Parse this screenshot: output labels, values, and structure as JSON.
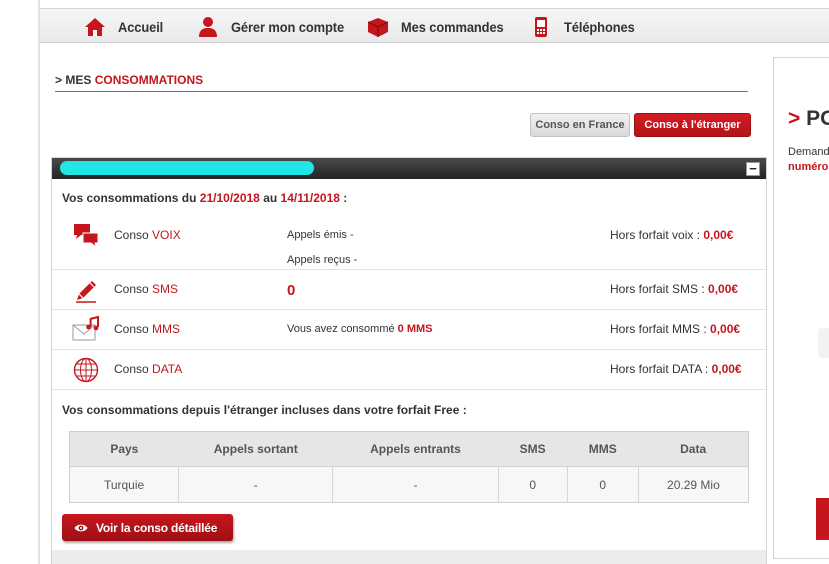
{
  "nav": {
    "items": [
      {
        "label": "Accueil",
        "icon": "home-icon"
      },
      {
        "label": "Gérer mon compte",
        "icon": "user-icon"
      },
      {
        "label": "Mes commandes",
        "icon": "box-icon"
      },
      {
        "label": "Téléphones",
        "icon": "phone-icon"
      }
    ]
  },
  "section": {
    "prefix": "> MES ",
    "highlight": "CONSOMMATIONS"
  },
  "buttons": {
    "france": "Conso en France",
    "abroad": "Conso à l'étranger",
    "detail": "Voir la conso détaillée"
  },
  "box": {
    "collapse": "−"
  },
  "period": {
    "prefix": "Vos consommations du ",
    "start": "21/10/2018",
    "middle": " au ",
    "end": "14/11/2018",
    "suffix": " :"
  },
  "rows": {
    "voice": {
      "label": "Conso ",
      "type": "VOIX",
      "emitted": "Appels émis -",
      "received": "Appels reçus -",
      "hf_label": "Hors forfait voix : ",
      "hf_value": "0,00€"
    },
    "sms": {
      "label": "Conso ",
      "type": "SMS",
      "count": "0",
      "hf_label": "Hors forfait SMS : ",
      "hf_value": "0,00€"
    },
    "mms": {
      "label": "Conso ",
      "type": "MMS",
      "consumed_prefix": "Vous avez consommé ",
      "consumed_value": "0 MMS",
      "hf_label": "Hors forfait MMS : ",
      "hf_value": "0,00€"
    },
    "data": {
      "label": "Conso ",
      "type": "DATA",
      "hf_label": "Hors forfait DATA : ",
      "hf_value": "0,00€"
    }
  },
  "abroad": {
    "title": "Vos consommations depuis l'étranger incluses dans votre forfait Free :",
    "headers": [
      "Pays",
      "Appels sortant",
      "Appels entrants",
      "SMS",
      "MMS",
      "Data"
    ],
    "rows": [
      [
        "Turquie",
        "-",
        "-",
        "0",
        "0",
        "20.29 Mio"
      ]
    ]
  },
  "side": {
    "title_prefix": "> ",
    "title": "PO",
    "line1": "Demand",
    "line2": "numéro"
  },
  "colors": {
    "brand_red": "#c4161c",
    "redaction": "#21e6e6"
  }
}
